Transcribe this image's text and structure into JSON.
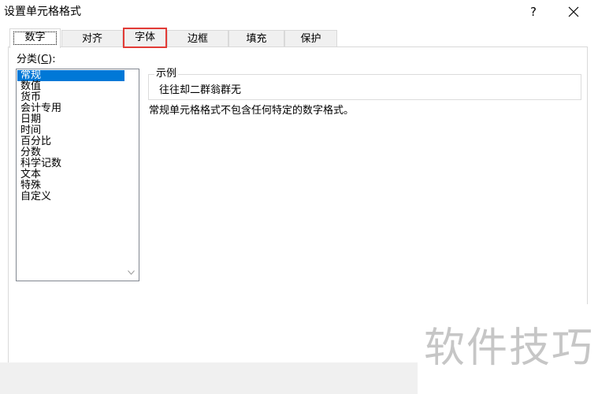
{
  "window": {
    "title": "设置单元格格式",
    "help_label": "?"
  },
  "tabs": [
    {
      "label": "数字"
    },
    {
      "label": "对齐"
    },
    {
      "label": "字体"
    },
    {
      "label": "边框"
    },
    {
      "label": "填充"
    },
    {
      "label": "保护"
    }
  ],
  "category": {
    "label_prefix": "分类(",
    "label_hotkey": "C",
    "label_suffix": "):",
    "items": [
      "常规",
      "数值",
      "货币",
      "会计专用",
      "日期",
      "时间",
      "百分比",
      "分数",
      "科学记数",
      "文本",
      "特殊",
      "自定义"
    ],
    "selected": "常规"
  },
  "sample": {
    "legend": "示例",
    "value": "往往却二群翁群无"
  },
  "description": "常规单元格格式不包含任何特定的数字格式。",
  "watermark": "软件技巧",
  "colors": {
    "selection": "#0078d7",
    "highlight_box": "#e23b36"
  },
  "icons": {
    "close": "close-icon",
    "scroll_down": "chevron-down-icon"
  }
}
